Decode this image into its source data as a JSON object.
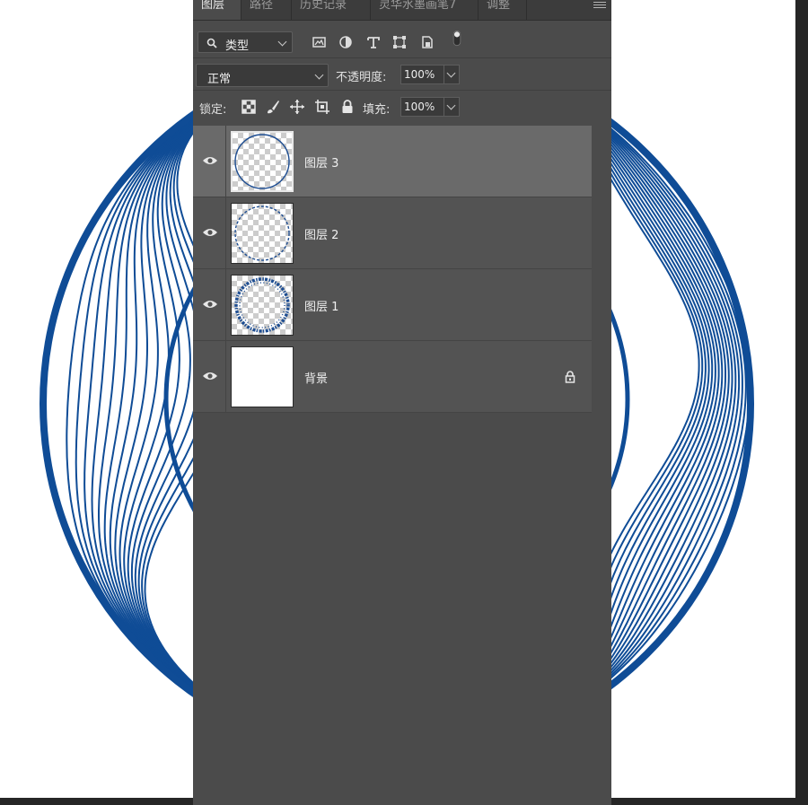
{
  "canvas": {
    "background": "#ffffff",
    "art_color": "#0f4c96"
  },
  "layers_panel": {
    "tabs": [
      {
        "label": "图层",
        "active": true
      },
      {
        "label": "路径",
        "active": false
      },
      {
        "label": "历史记录",
        "active": false
      },
      {
        "label": "灵华水墨画笔7",
        "active": false
      },
      {
        "label": "调整",
        "active": false
      }
    ],
    "filter": {
      "value": "类型",
      "icons": [
        "image-filter-icon",
        "adjustment-filter-icon",
        "type-filter-icon",
        "shape-filter-icon",
        "smart-object-filter-icon",
        "filter-toggle-icon"
      ]
    },
    "blend_mode": "正常",
    "opacity": {
      "label": "不透明度:",
      "value": "100%"
    },
    "lock": {
      "label": "锁定:",
      "icons": [
        "lock-transparent-pixels-icon",
        "lock-image-pixels-icon",
        "lock-position-icon",
        "lock-artboard-icon",
        "lock-all-icon"
      ]
    },
    "fill": {
      "label": "填充:",
      "value": "100%"
    },
    "layers": [
      {
        "name": "图层 3",
        "selected": true,
        "visible": true,
        "locked": false,
        "thumb": "thin-circle"
      },
      {
        "name": "图层 2",
        "selected": false,
        "visible": true,
        "locked": false,
        "thumb": "dashed-circle"
      },
      {
        "name": "图层 1",
        "selected": false,
        "visible": true,
        "locked": false,
        "thumb": "speckled-ring"
      },
      {
        "name": "背景",
        "selected": false,
        "visible": true,
        "locked": true,
        "thumb": "white"
      }
    ]
  }
}
